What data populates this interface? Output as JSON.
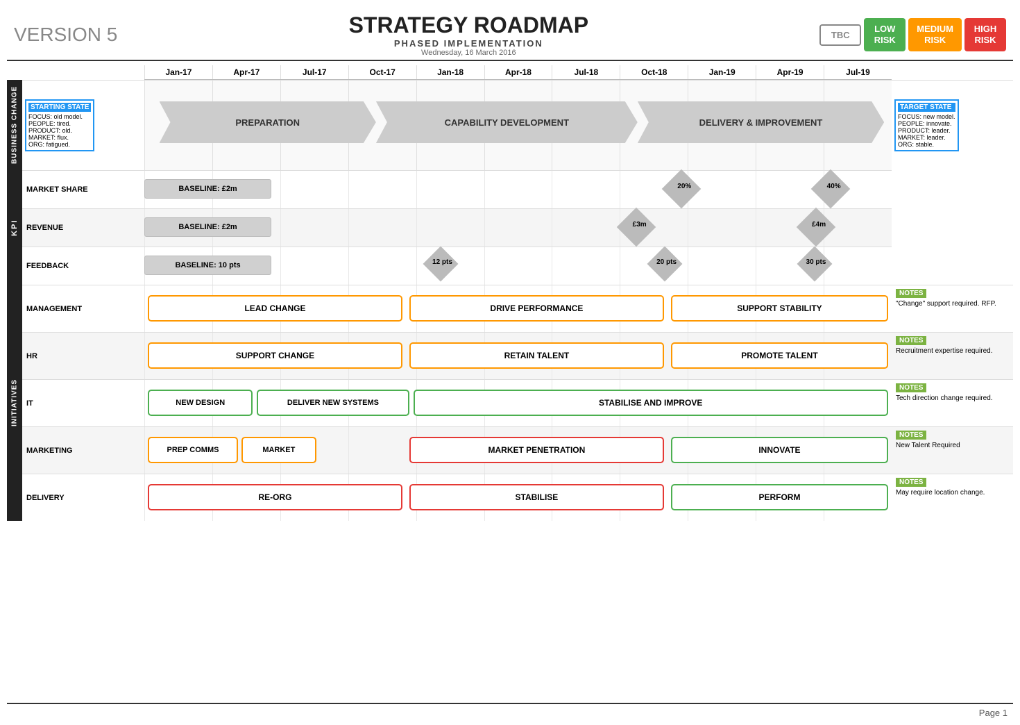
{
  "header": {
    "version": "VERSION 5",
    "title": "STRATEGY ROADMAP",
    "subtitle": "PHASED IMPLEMENTATION",
    "date": "Wednesday, 16 March 2016",
    "risk_tbc": "TBC",
    "risk_low": "LOW\nRISK",
    "risk_medium": "MEDIUM\nRISK",
    "risk_high": "HIGH\nRISK"
  },
  "timeline": {
    "columns": [
      "Jan-17",
      "Apr-17",
      "Jul-17",
      "Oct-17",
      "Jan-18",
      "Apr-18",
      "Jul-18",
      "Oct-18",
      "Jan-19",
      "Apr-19",
      "Jul-19"
    ]
  },
  "business_change": {
    "tab": "BUSINESS CHANGE",
    "starting_state": {
      "title": "STARTING STATE",
      "lines": [
        "FOCUS: old model.",
        "PEOPLE: tired.",
        "PRODUCT: old.",
        "MARKET: flux.",
        "ORG: fatigued."
      ]
    },
    "target_state": {
      "title": "TARGET STATE",
      "lines": [
        "FOCUS: new model.",
        "PEOPLE: innovate.",
        "PRODUCT: leader.",
        "MARKET: leader.",
        "ORG: stable."
      ]
    },
    "phases": [
      "PREPARATION",
      "CAPABILITY DEVELOPMENT",
      "DELIVERY & IMPROVEMENT"
    ]
  },
  "kpi": {
    "tab": "KPI",
    "rows": [
      {
        "label": "MARKET SHARE",
        "baseline": "BASELINE: £2m",
        "milestones": [
          {
            "pos": 8,
            "label": "20%"
          },
          {
            "pos": 10,
            "label": "40%"
          }
        ]
      },
      {
        "label": "REVENUE",
        "baseline": "BASELINE: £2m",
        "milestones": [
          {
            "pos": 8,
            "label": "£3m"
          },
          {
            "pos": 10,
            "label": "£4m"
          }
        ]
      },
      {
        "label": "FEEDBACK",
        "baseline": "BASELINE: 10 pts",
        "milestones": [
          {
            "pos": 4.5,
            "label": "12 pts"
          },
          {
            "pos": 8,
            "label": "20 pts"
          },
          {
            "pos": 10,
            "label": "30 pts"
          }
        ]
      }
    ]
  },
  "initiatives": {
    "tab": "INITIATIVES",
    "rows": [
      {
        "label": "MANAGEMENT",
        "boxes": [
          {
            "label": "LEAD CHANGE",
            "color": "orange",
            "start": 0,
            "end": 3.8
          },
          {
            "label": "DRIVE PERFORMANCE",
            "color": "orange",
            "start": 4.1,
            "end": 7.8
          },
          {
            "label": "SUPPORT STABILITY",
            "color": "orange",
            "start": 8.1,
            "end": 11.8
          }
        ],
        "notes_label": "NOTES",
        "notes_text": "\"Change\" support required. RFP."
      },
      {
        "label": "HR",
        "boxes": [
          {
            "label": "SUPPORT CHANGE",
            "color": "orange",
            "start": 0,
            "end": 3.8
          },
          {
            "label": "RETAIN TALENT",
            "color": "orange",
            "start": 4.1,
            "end": 7.8
          },
          {
            "label": "PROMOTE TALENT",
            "color": "orange",
            "start": 8.1,
            "end": 11.8
          }
        ],
        "notes_label": "NOTES",
        "notes_text": "Recruitment expertise required."
      },
      {
        "label": "IT",
        "boxes": [
          {
            "label": "NEW DESIGN",
            "color": "green",
            "start": 0,
            "end": 1.6
          },
          {
            "label": "DELIVER NEW SYSTEMS",
            "color": "green",
            "start": 1.8,
            "end": 5.8
          },
          {
            "label": "STABILISE AND IMPROVE",
            "color": "green",
            "start": 6.1,
            "end": 11.8
          }
        ],
        "notes_label": "NOTES",
        "notes_text": "Tech direction change required."
      },
      {
        "label": "MARKETING",
        "boxes": [
          {
            "label": "PREP COMMS",
            "color": "orange",
            "start": 0,
            "end": 1.5
          },
          {
            "label": "MARKET",
            "color": "orange",
            "start": 1.7,
            "end": 3.8
          },
          {
            "label": "MARKET PENETRATION",
            "color": "red",
            "start": 4.1,
            "end": 7.8
          },
          {
            "label": "INNOVATE",
            "color": "green",
            "start": 8.1,
            "end": 11.8
          }
        ],
        "notes_label": "NOTES",
        "notes_text": "New Talent Required"
      },
      {
        "label": "DELIVERY",
        "boxes": [
          {
            "label": "RE-ORG",
            "color": "red",
            "start": 0,
            "end": 3.8
          },
          {
            "label": "STABILISE",
            "color": "red",
            "start": 4.1,
            "end": 7.8
          },
          {
            "label": "PERFORM",
            "color": "green",
            "start": 8.1,
            "end": 11.8
          }
        ],
        "notes_label": "NOTES",
        "notes_text": "May require location change."
      }
    ]
  },
  "page": "Page 1"
}
